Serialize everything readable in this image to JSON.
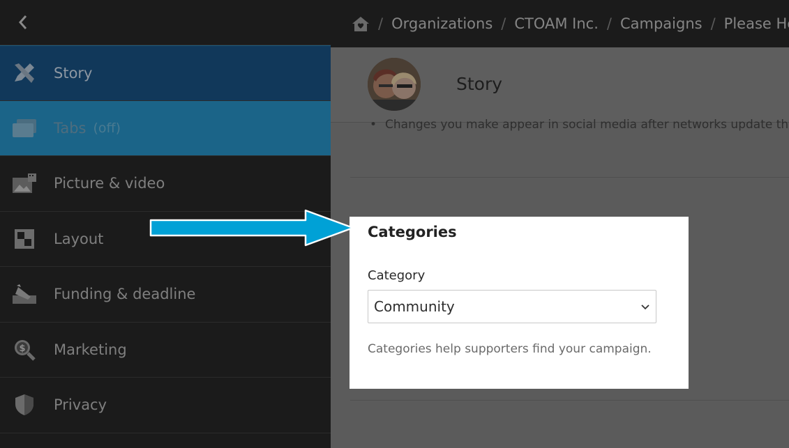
{
  "sidebar": {
    "back_icon": "chevron-left-icon",
    "items": [
      {
        "label": "Story",
        "icon": "pencil-ruler-icon"
      },
      {
        "label": "Tabs",
        "suffix": "(off)",
        "icon": "folders-icon"
      },
      {
        "label": "Picture & video",
        "icon": "photo-video-icon"
      },
      {
        "label": "Layout",
        "icon": "layout-grid-icon"
      },
      {
        "label": "Funding & deadline",
        "icon": "edit-pen-icon"
      },
      {
        "label": "Marketing",
        "icon": "dollar-search-icon"
      },
      {
        "label": "Privacy",
        "icon": "shield-icon"
      }
    ]
  },
  "breadcrumb": {
    "home_icon": "home-heart-icon",
    "separator": "/",
    "items": [
      "Organizations",
      "CTOAM Inc.",
      "Campaigns",
      "Please Help C"
    ]
  },
  "story": {
    "title": "Story",
    "bullet": "Changes you make appear in social media after networks update their"
  },
  "categories": {
    "title": "Categories",
    "field_label": "Category",
    "selected_value": "Community",
    "help_text": "Categories help supporters find your campaign."
  },
  "colors": {
    "arrow": "#00a1d6",
    "sidebar_bg": "#1b1b1b",
    "active_item": "#11385a",
    "tabs_item": "#1b6488"
  }
}
